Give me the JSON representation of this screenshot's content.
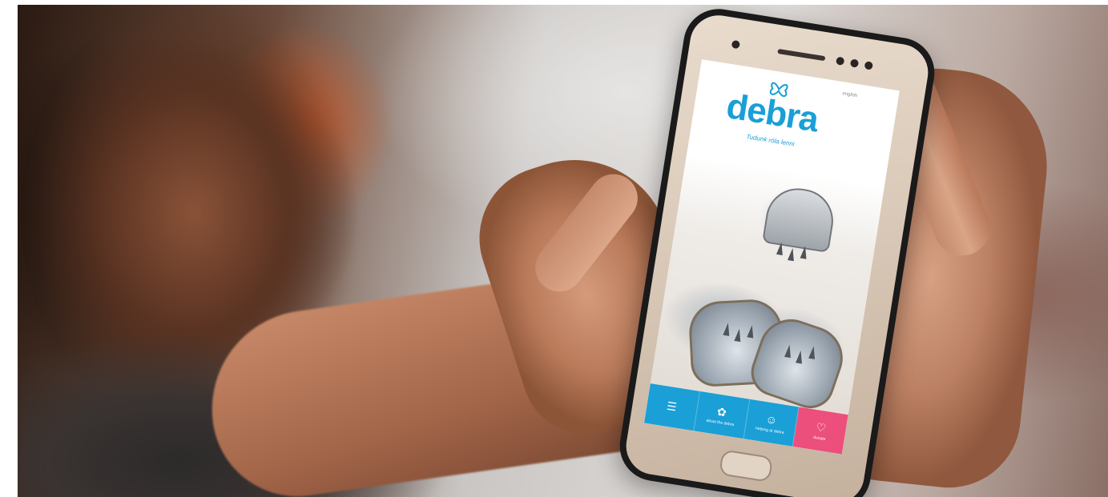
{
  "scene": {
    "description_colors": {
      "brand_blue": "#1a9fd6",
      "donate_pink": "#ec4f7c"
    }
  },
  "app": {
    "logo_text": "debra",
    "tagline": "Tudunk róla lenni",
    "language": "english",
    "tabs": [
      {
        "icon": "menu-icon",
        "label": ""
      },
      {
        "icon": "butterfly-icon",
        "label": "about the debra"
      },
      {
        "icon": "person-icon",
        "label": "helping at debra"
      },
      {
        "icon": "heart-icon",
        "label": "donate"
      }
    ]
  }
}
